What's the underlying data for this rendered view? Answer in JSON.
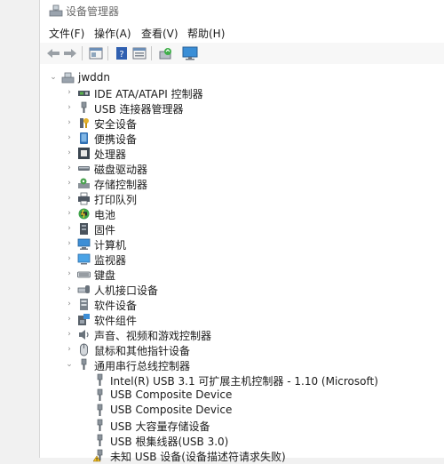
{
  "window": {
    "title": "设备管理器"
  },
  "menu": [
    "文件(F)",
    "操作(A)",
    "查看(V)",
    "帮助(H)"
  ],
  "toolbar": {
    "buttons": [
      "back-arrow-icon",
      "forward-arrow-icon",
      "properties-icon",
      "help-icon",
      "details-view-icon",
      "update-driver-icon",
      "monitor-scan-icon"
    ]
  },
  "tree": {
    "root": "jwddn",
    "categories": [
      {
        "label": "IDE ATA/ATAPI 控制器",
        "icon": "ide-controller-icon"
      },
      {
        "label": "USB 连接器管理器",
        "icon": "usb-connector-icon"
      },
      {
        "label": "安全设备",
        "icon": "security-device-icon"
      },
      {
        "label": "便携设备",
        "icon": "portable-device-icon"
      },
      {
        "label": "处理器",
        "icon": "processor-icon"
      },
      {
        "label": "磁盘驱动器",
        "icon": "disk-drive-icon"
      },
      {
        "label": "存储控制器",
        "icon": "storage-controller-icon"
      },
      {
        "label": "打印队列",
        "icon": "print-queue-icon"
      },
      {
        "label": "电池",
        "icon": "battery-icon"
      },
      {
        "label": "固件",
        "icon": "firmware-icon"
      },
      {
        "label": "计算机",
        "icon": "computer-icon"
      },
      {
        "label": "监视器",
        "icon": "monitor-icon"
      },
      {
        "label": "键盘",
        "icon": "keyboard-icon"
      },
      {
        "label": "人机接口设备",
        "icon": "hid-icon"
      },
      {
        "label": "软件设备",
        "icon": "software-device-icon"
      },
      {
        "label": "软件组件",
        "icon": "software-component-icon"
      },
      {
        "label": "声音、视频和游戏控制器",
        "icon": "sound-icon"
      },
      {
        "label": "鼠标和其他指针设备",
        "icon": "mouse-icon"
      },
      {
        "label": "通用串行总线控制器",
        "icon": "usb-controller-icon"
      }
    ],
    "usb_children": [
      {
        "label": "Intel(R) USB 3.1 可扩展主机控制器 - 1.10 (Microsoft)",
        "icon": "usb-plug-icon"
      },
      {
        "label": "USB Composite Device",
        "icon": "usb-plug-icon"
      },
      {
        "label": "USB Composite Device",
        "icon": "usb-plug-icon"
      },
      {
        "label": "USB 大容量存储设备",
        "icon": "usb-plug-icon"
      },
      {
        "label": "USB 根集线器(USB 3.0)",
        "icon": "usb-plug-icon"
      },
      {
        "label": "未知 USB 设备(设备描述符请求失败)",
        "icon": "warning-usb-icon"
      }
    ]
  }
}
